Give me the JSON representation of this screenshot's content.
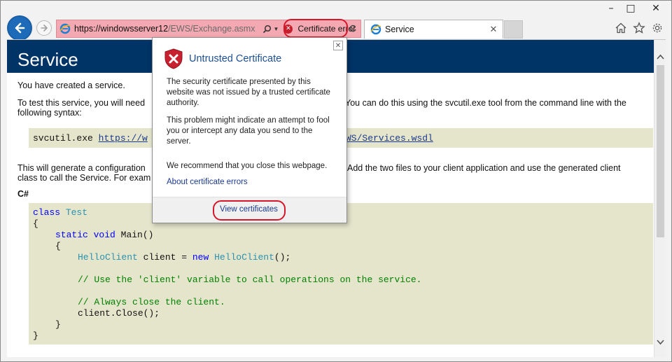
{
  "browser": {
    "address_url_host": "https://windowsserver12",
    "address_url_rest": "/EWS/Exchange.asmx",
    "cert_error_label": "Certificate error",
    "tab_title": "Service"
  },
  "page": {
    "title": "Service",
    "created_text": "You have created a service.",
    "test_line1_a": "To test this service, you will need",
    "test_line1_b": "You can do this using the svcutil.exe tool from the command line with the",
    "test_line2": "following syntax:",
    "svcutil_cmd": "svcutil.exe",
    "svcutil_url_a": "https://w",
    "svcutil_url_b": "WS/Services.wsdl",
    "generate_line1_a": "This will generate a configuration",
    "generate_line1_b": "Add the two files to your client application and use the generated client",
    "generate_line2": "class to call the Service. For exam",
    "csharp_label": "C#",
    "code": {
      "class_kw": "class",
      "class_name": "Test",
      "open1": "{",
      "static_kw": "static",
      "void_kw": "void",
      "main": "Main()",
      "open2": "{",
      "hello_type": "HelloClient",
      "client_assign": "client =",
      "new_kw": "new",
      "hello_ctor": "HelloClient",
      "ctor_end": "();",
      "comment1": "// Use the 'client' variable to call operations on the service.",
      "comment2": "// Always close the client.",
      "close_call": "client.Close();",
      "close2": "}",
      "close1": "}"
    }
  },
  "popup": {
    "title": "Untrusted Certificate",
    "para1": "The security certificate presented by this website was not issued by a trusted certificate authority.",
    "para2": "This problem might indicate an attempt to fool you or intercept any data you send to the server.",
    "para3": "We recommend that you close this webpage.",
    "about_link": "About certificate errors",
    "view_certs": "View certificates"
  },
  "colors": {
    "header_bg": "#003366",
    "address_error_bg": "#f4a8b1",
    "highlight_ring": "#d6162a",
    "code_bg": "#e5e5cc"
  }
}
